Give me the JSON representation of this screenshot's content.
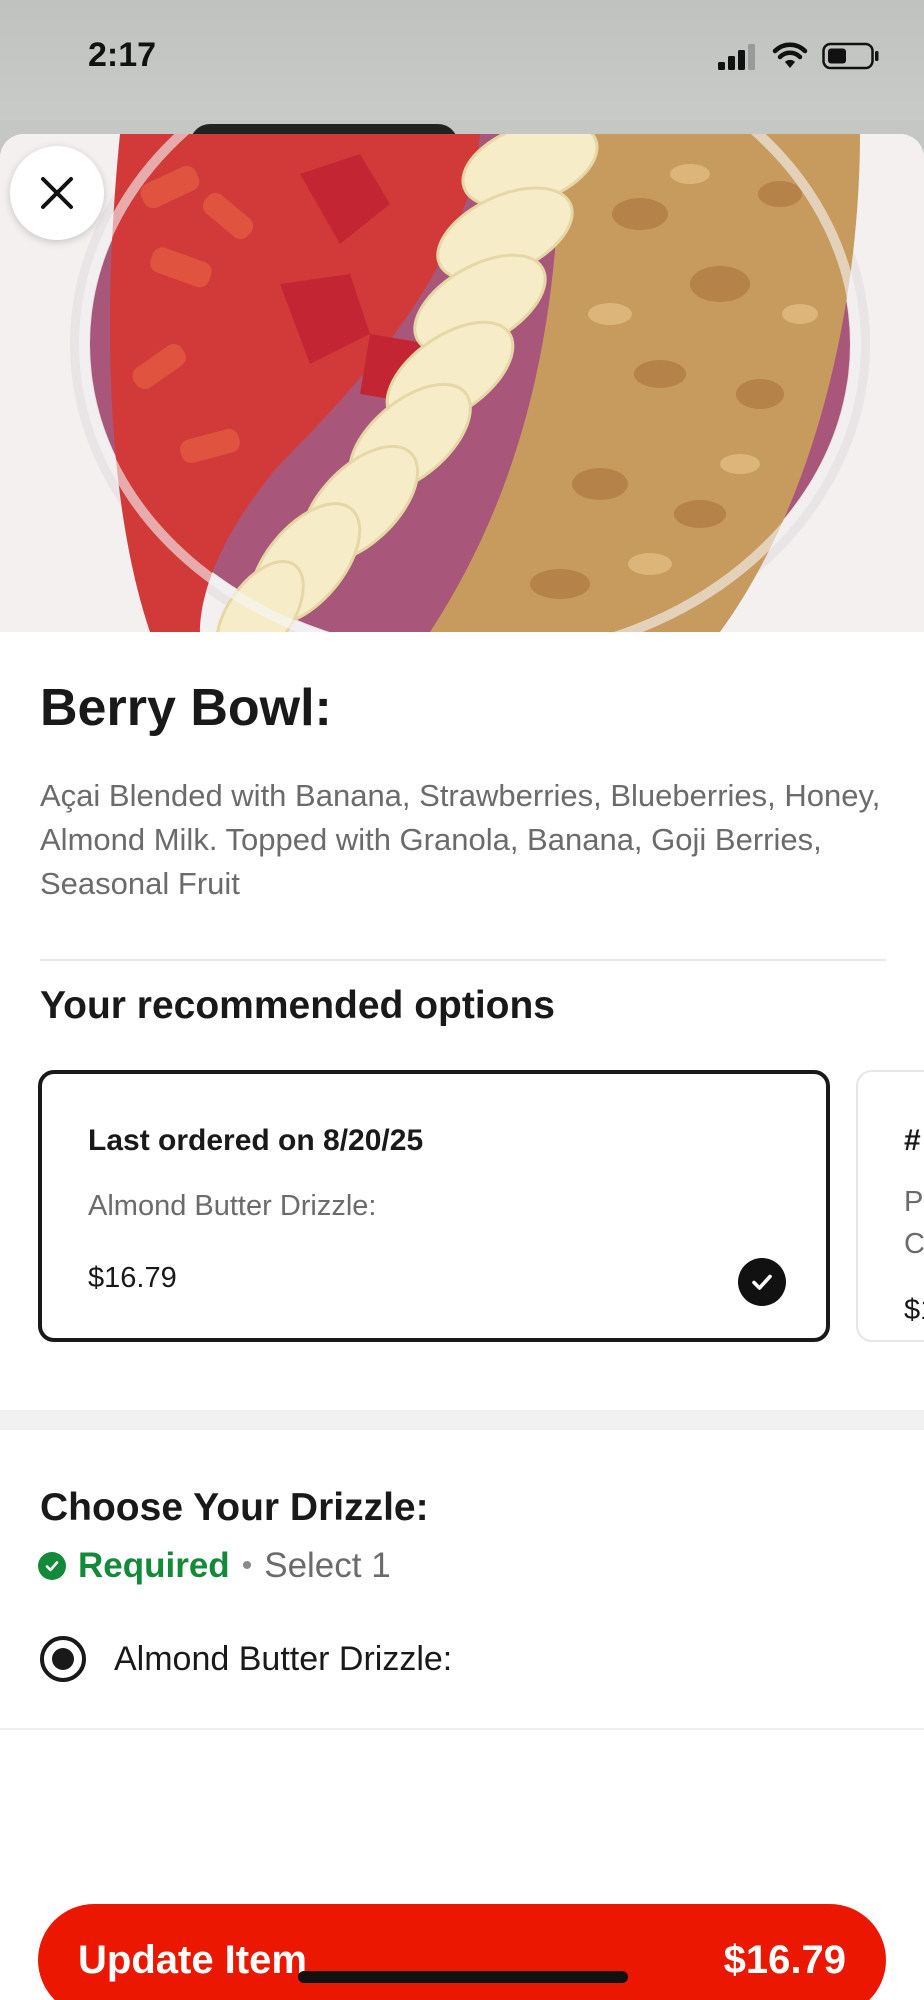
{
  "status_bar": {
    "time": "2:17",
    "icons": [
      "signal-icon",
      "wifi-icon",
      "battery-icon"
    ]
  },
  "item": {
    "title": "Berry Bowl:",
    "description": "Açai Blended with Banana, Strawberries, Blueberries, Honey, Almond Milk.  Topped with Granola, Banana, Goji Berries, Seasonal Fruit",
    "image_alt_icon": "food-photo"
  },
  "recommended": {
    "section_title": "Your recommended options",
    "cards": [
      {
        "title": "Last ordered on 8/20/25",
        "subtitle": "Almond Butter Drizzle:",
        "price": "$16.79",
        "selected": true
      },
      {
        "title": "#",
        "line1": "P",
        "line2": "C",
        "price": "$1"
      }
    ]
  },
  "drizzle": {
    "title": "Choose Your Drizzle:",
    "required_label": "Required",
    "separator": "•",
    "select_rule": "Select 1",
    "options": [
      {
        "label": "Almond Butter Drizzle:",
        "selected": true
      }
    ]
  },
  "footer": {
    "button_label": "Update Item",
    "button_price": "$16.79"
  },
  "colors": {
    "accent_red": "#eb1700",
    "required_green": "#138a3a",
    "text_primary": "#191919",
    "text_secondary": "#6b6b6b"
  }
}
